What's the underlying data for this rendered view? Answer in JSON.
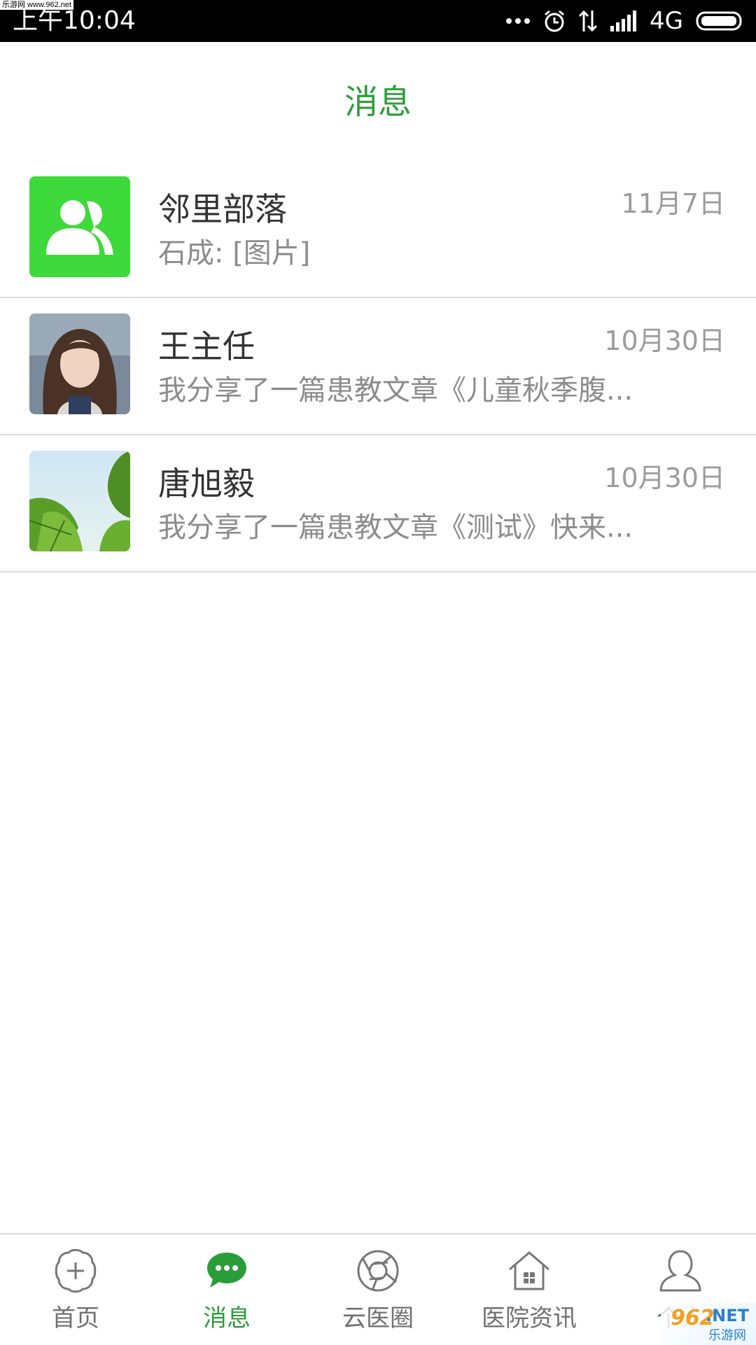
{
  "status_bar": {
    "watermark": "乐游网 www.962.net",
    "time": "上午10:04",
    "network": "4G",
    "icons": [
      "more-dots-icon",
      "alarm-icon",
      "data-arrows-icon",
      "signal-icon",
      "battery-icon"
    ]
  },
  "header": {
    "title": "消息"
  },
  "conversations": [
    {
      "name": "邻里部落",
      "date": "11月7日",
      "preview": "石成: [图片]",
      "avatar": "group-icon"
    },
    {
      "name": "王主任",
      "date": "10月30日",
      "preview": "我分享了一篇患教文章《儿童秋季腹...",
      "avatar": "person-photo"
    },
    {
      "name": "唐旭毅",
      "date": "10月30日",
      "preview": "我分享了一篇患教文章《测试》快来...",
      "avatar": "leaf-photo"
    }
  ],
  "tabs": [
    {
      "label": "首页",
      "icon": "home-cross-icon",
      "active": false
    },
    {
      "label": "消息",
      "icon": "chat-bubble-icon",
      "active": true
    },
    {
      "label": "云医圈",
      "icon": "aperture-icon",
      "active": false
    },
    {
      "label": "医院资讯",
      "icon": "hospital-house-icon",
      "active": false
    },
    {
      "label": "个人",
      "icon": "person-icon",
      "active": false
    }
  ],
  "overlay_watermark": {
    "part1": "962",
    "part2": ".NET",
    "part3": "乐游网"
  },
  "colors": {
    "accent": "#2e9e3a",
    "group_avatar_bg": "#3ed93a"
  }
}
